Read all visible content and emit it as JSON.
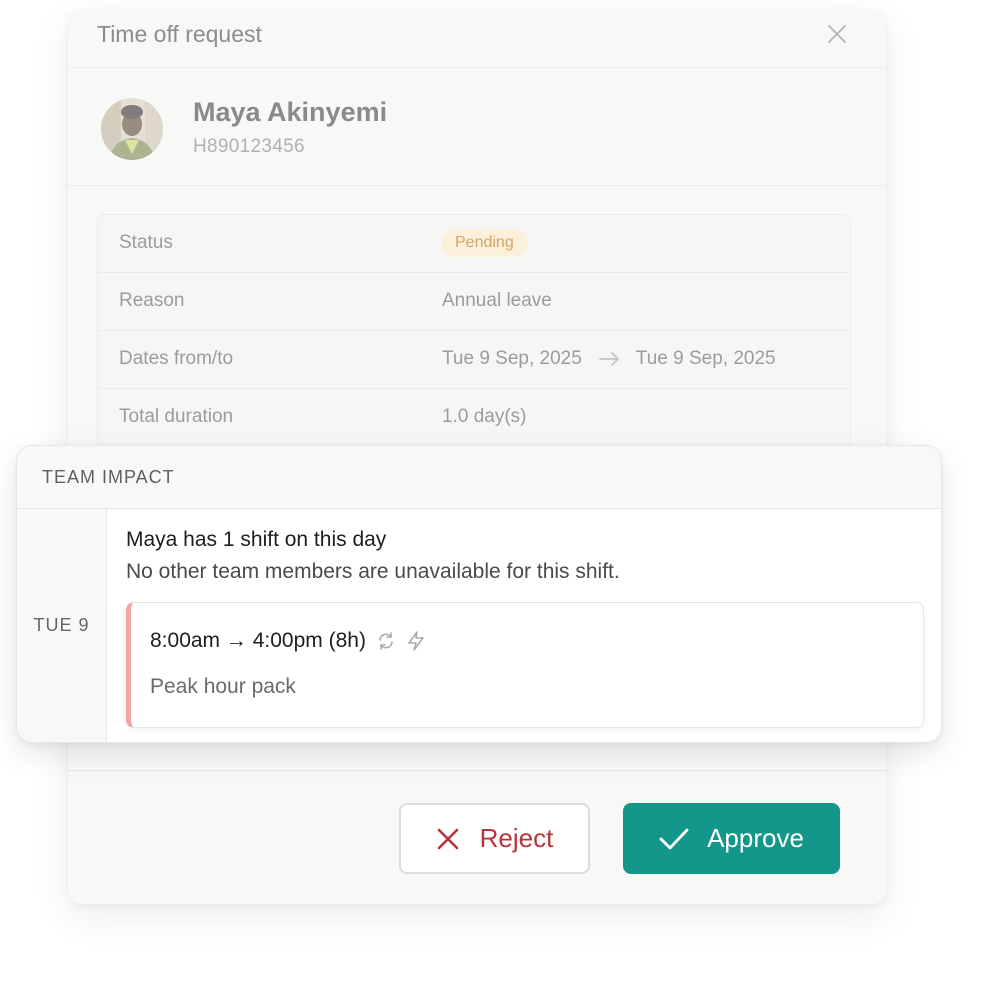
{
  "modal": {
    "title": "Time off request"
  },
  "employee": {
    "name": "Maya Akinyemi",
    "id": "H890123456"
  },
  "details": {
    "status_label": "Status",
    "status_value": "Pending",
    "reason_label": "Reason",
    "reason_value": "Annual leave",
    "dates_label": "Dates from/to",
    "date_from": "Tue 9 Sep, 2025",
    "date_to": "Tue 9 Sep, 2025",
    "duration_label": "Total duration",
    "duration_value": "1.0 day(s)"
  },
  "team_impact": {
    "title": "TEAM IMPACT",
    "day": "TUE 9",
    "heading": "Maya has 1 shift on this day",
    "subtext": "No other team members are unavailable for this shift.",
    "shift": {
      "time": "8:00am → 4:00pm (8h)",
      "name": "Peak hour pack",
      "icons": [
        "repeat-icon",
        "lightning-icon"
      ]
    }
  },
  "actions": {
    "reject_label": "Reject",
    "approve_label": "Approve"
  },
  "colors": {
    "approve": "#13978a",
    "reject": "#b7343b",
    "pending_bg": "#fbf0d9",
    "pending_text": "#d2a46a",
    "shift_accent": "#f3a4a4"
  }
}
